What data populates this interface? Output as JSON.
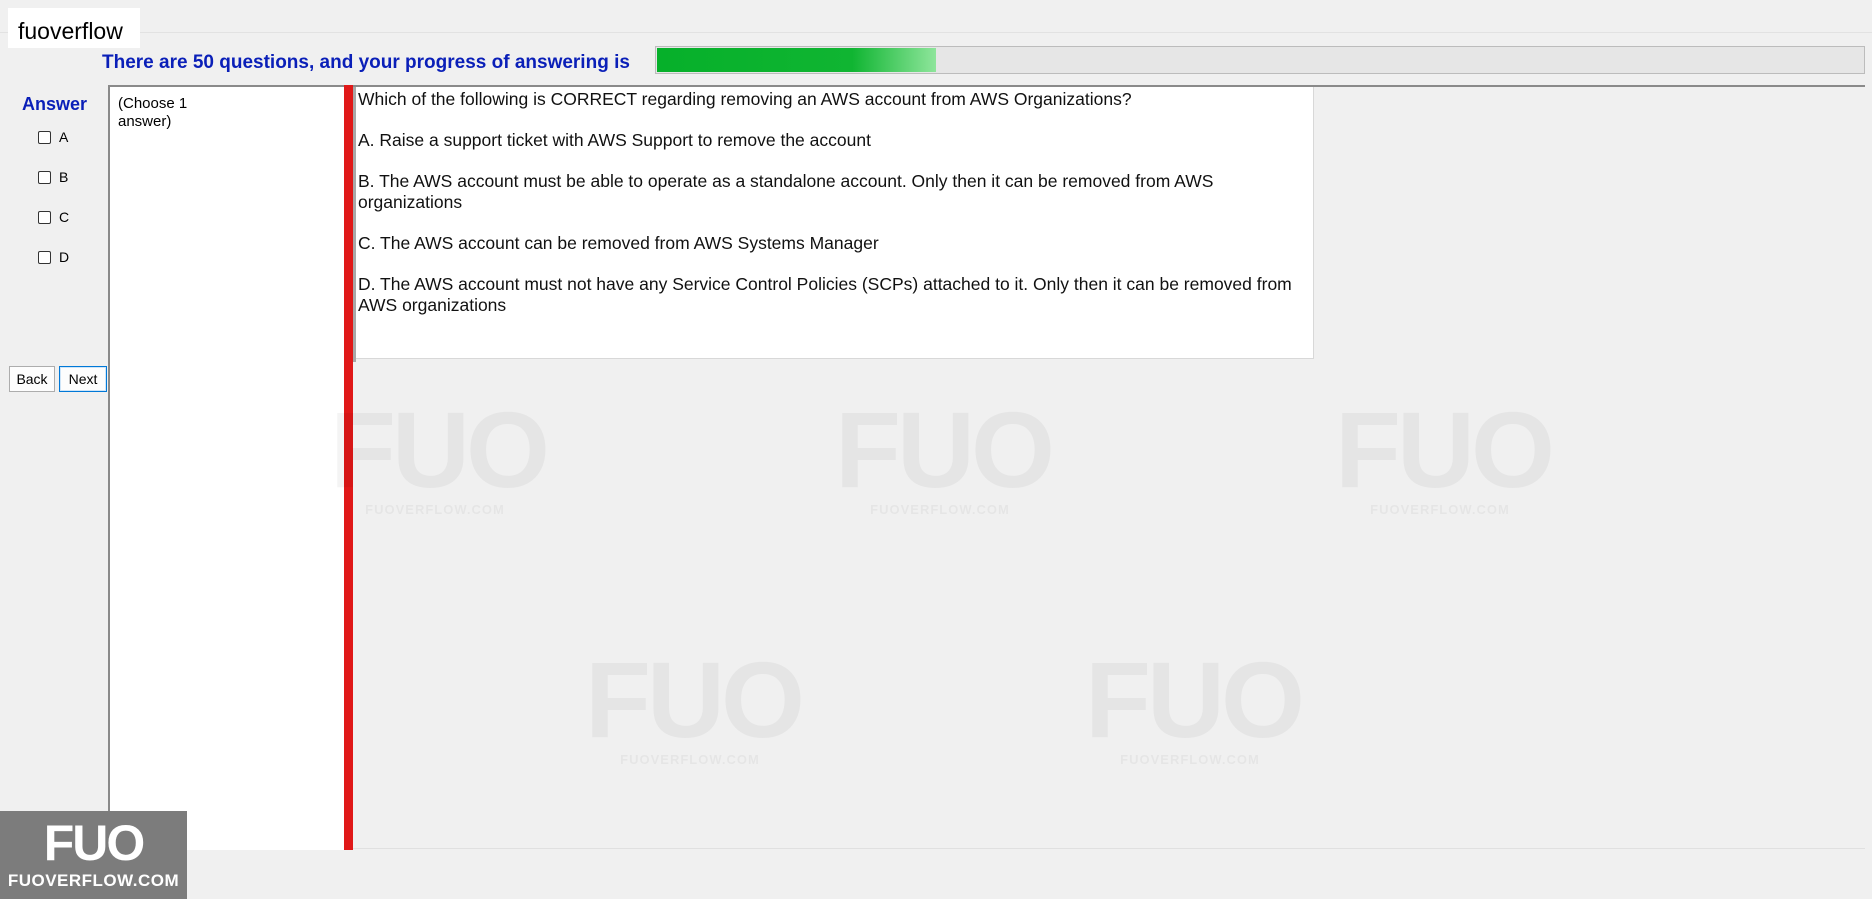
{
  "window": {
    "title": "fuoverflow"
  },
  "progress": {
    "label": "There are 50 questions, and your progress of answering is",
    "fraction": 0.233,
    "fill_color": "#06b02a"
  },
  "answer_panel": {
    "title": "Answer",
    "options": [
      {
        "label": "A",
        "checked": false
      },
      {
        "label": "B",
        "checked": false
      },
      {
        "label": "C",
        "checked": false
      },
      {
        "label": "D",
        "checked": false
      }
    ],
    "back_label": "Back",
    "next_label": "Next"
  },
  "instruction": "(Choose 1 answer)",
  "question": {
    "text": "Which of the following is CORRECT regarding removing an AWS account from AWS Organizations?",
    "choices": [
      "A.  Raise a support ticket with AWS Support to remove the account",
      "B.  The AWS account must be able to operate as a standalone account. Only then it can be removed from AWS organizations",
      "C.  The AWS account can be removed from AWS Systems Manager",
      "D.  The AWS account must not have any Service Control Policies (SCPs) attached to it. Only then it can be removed from AWS organizations"
    ]
  },
  "watermark": {
    "big": "FUO",
    "small": "FUOVERFLOW.COM"
  },
  "logo": {
    "big": "FUO",
    "small": "FUOVERFLOW.COM"
  },
  "colors": {
    "accent_text": "#0a1fb8",
    "divider": "#e01818"
  }
}
